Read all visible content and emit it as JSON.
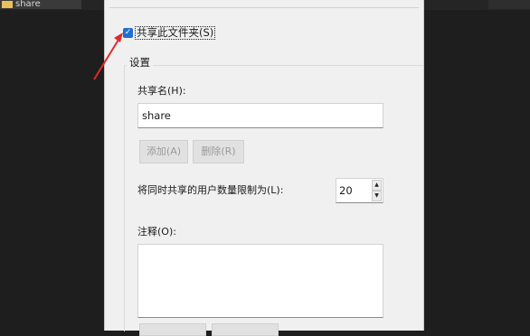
{
  "background_window": {
    "tab_title": "share"
  },
  "dialog": {
    "share_checkbox": {
      "label": "共享此文件夹(S)",
      "checked": true,
      "check_glyph": "✓"
    },
    "settings_group": {
      "title": "设置"
    },
    "share_name": {
      "label": "共享名(H):",
      "value": "share"
    },
    "add_button": {
      "label": "添加(A)"
    },
    "remove_button": {
      "label": "删除(R)"
    },
    "user_limit": {
      "label": "将同时共享的用户数量限制为(L):",
      "value": "20"
    },
    "comments": {
      "label": "注释(O):",
      "value": ""
    }
  },
  "annotation": {
    "arrow_color": "#e02a2a"
  },
  "icons": {
    "spinner_up": "▲",
    "spinner_down": "▼",
    "check": "check-icon",
    "arrow": "red-arrow-annotation"
  }
}
